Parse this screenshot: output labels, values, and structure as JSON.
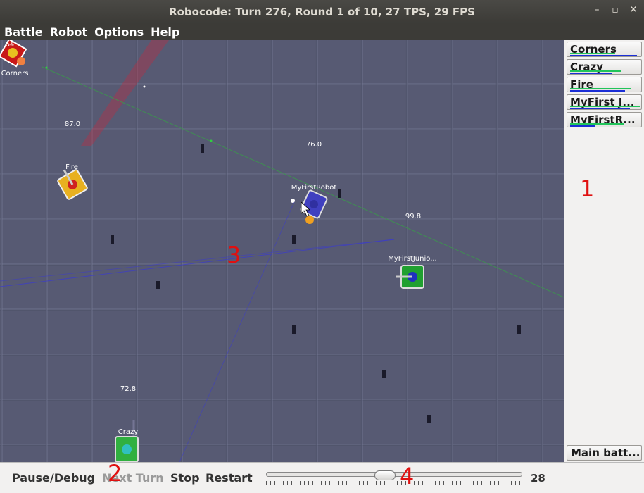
{
  "window": {
    "title": "Robocode: Turn 276, Round 1 of 10, 27 TPS, 29 FPS",
    "controls": [
      "minimize-icon",
      "maximize-icon",
      "close-icon"
    ]
  },
  "menu": {
    "items": [
      {
        "mnemonic": "B",
        "rest": "attle"
      },
      {
        "mnemonic": "R",
        "rest": "obot"
      },
      {
        "mnemonic": "O",
        "rest": "ptions"
      },
      {
        "mnemonic": "H",
        "rest": "elp"
      }
    ]
  },
  "battlefield": {
    "robots": [
      {
        "name": "Corners",
        "energy": "64",
        "color": "#d02020"
      },
      {
        "name": "Fire",
        "energy": "87.0",
        "color": "#e8b020"
      },
      {
        "name": "MyFirstRobot",
        "energy": "76.0",
        "color": "#4040c0"
      },
      {
        "name": "MyFirstJunio...",
        "energy": "99.8",
        "color": "#20a030"
      },
      {
        "name": "Crazy",
        "energy": "72.8",
        "color": "#30b040"
      }
    ],
    "annotations": [
      "1",
      "2",
      "3",
      "4"
    ]
  },
  "sidepanel": {
    "robot_buttons": [
      {
        "label": "Corners",
        "energy_frac": 0.64,
        "gun_frac": 0.95
      },
      {
        "label": "Crazy",
        "energy_frac": 0.73,
        "gun_frac": 0.6
      },
      {
        "label": "Fire",
        "energy_frac": 0.87,
        "gun_frac": 0.78
      },
      {
        "label": "MyFirst J...",
        "energy_frac": 0.998,
        "gun_frac": 0.85
      },
      {
        "label": "MyFirstR...",
        "energy_frac": 0.76,
        "gun_frac": 0.35
      }
    ],
    "main_battle_label": "Main batt..."
  },
  "toolbar": {
    "pause_label": "Pause/Debug",
    "next_turn_label": "Next Turn",
    "stop_label": "Stop",
    "restart_label": "Restart",
    "tps_value": "28",
    "tps_slider_fraction": 0.46
  },
  "colors": {
    "energy_bar": "#21c45a",
    "gun_bar": "#1b2fd6",
    "annotation": "#e01010"
  }
}
